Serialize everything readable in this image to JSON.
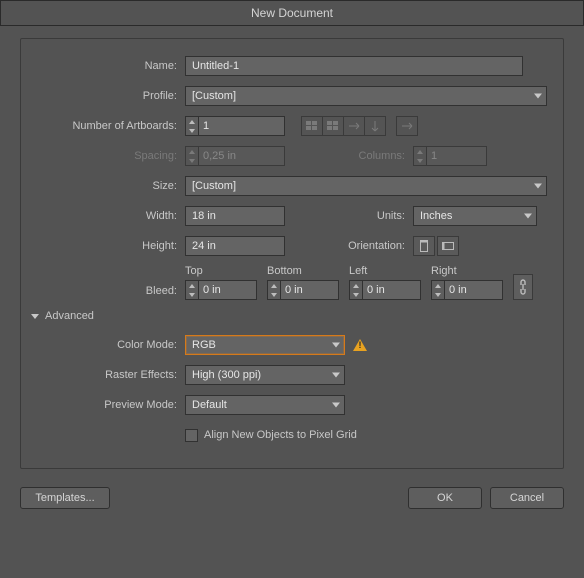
{
  "title": "New Document",
  "labels": {
    "name": "Name:",
    "profile": "Profile:",
    "numArtboards": "Number of Artboards:",
    "spacing": "Spacing:",
    "columns": "Columns:",
    "size": "Size:",
    "width": "Width:",
    "height": "Height:",
    "units": "Units:",
    "orientation": "Orientation:",
    "bleed": "Bleed:",
    "top": "Top",
    "bottom": "Bottom",
    "left": "Left",
    "right": "Right",
    "advanced": "Advanced",
    "colorMode": "Color Mode:",
    "rasterEffects": "Raster Effects:",
    "previewMode": "Preview Mode:",
    "align": "Align New Objects to Pixel Grid"
  },
  "values": {
    "name": "Untitled-1",
    "profile": "[Custom]",
    "numArtboards": "1",
    "spacing": "0,25 in",
    "columns": "1",
    "size": "[Custom]",
    "width": "18 in",
    "height": "24 in",
    "units": "Inches",
    "bleedTop": "0 in",
    "bleedBottom": "0 in",
    "bleedLeft": "0 in",
    "bleedRight": "0 in",
    "colorMode": "RGB",
    "rasterEffects": "High (300 ppi)",
    "previewMode": "Default"
  },
  "buttons": {
    "templates": "Templates...",
    "ok": "OK",
    "cancel": "Cancel"
  }
}
